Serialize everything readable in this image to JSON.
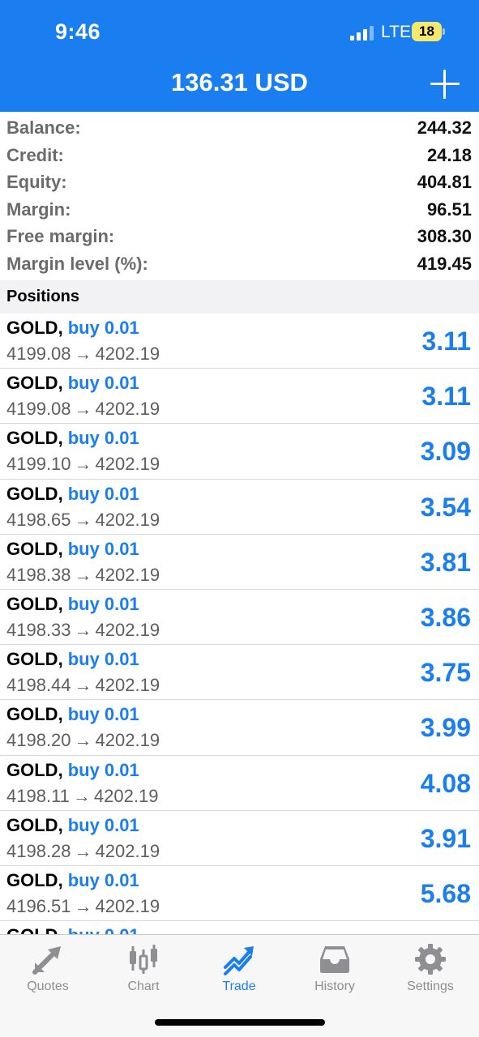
{
  "status_bar": {
    "time": "9:46",
    "network": "LTE",
    "battery": "18"
  },
  "header": {
    "title": "136.31 USD",
    "add_icon": "plus-icon"
  },
  "summary": [
    {
      "label": "Balance:",
      "value": "244.32"
    },
    {
      "label": "Credit:",
      "value": "24.18"
    },
    {
      "label": "Equity:",
      "value": "404.81"
    },
    {
      "label": "Margin:",
      "value": "96.51"
    },
    {
      "label": "Free margin:",
      "value": "308.30"
    },
    {
      "label": "Margin level (%):",
      "value": "419.45"
    }
  ],
  "positions_header": "Positions",
  "positions": [
    {
      "symbol": "GOLD",
      "side": "buy 0.01",
      "open": "4199.08",
      "current": "4202.19",
      "profit": "3.11"
    },
    {
      "symbol": "GOLD",
      "side": "buy 0.01",
      "open": "4199.08",
      "current": "4202.19",
      "profit": "3.11"
    },
    {
      "symbol": "GOLD",
      "side": "buy 0.01",
      "open": "4199.10",
      "current": "4202.19",
      "profit": "3.09"
    },
    {
      "symbol": "GOLD",
      "side": "buy 0.01",
      "open": "4198.65",
      "current": "4202.19",
      "profit": "3.54"
    },
    {
      "symbol": "GOLD",
      "side": "buy 0.01",
      "open": "4198.38",
      "current": "4202.19",
      "profit": "3.81"
    },
    {
      "symbol": "GOLD",
      "side": "buy 0.01",
      "open": "4198.33",
      "current": "4202.19",
      "profit": "3.86"
    },
    {
      "symbol": "GOLD",
      "side": "buy 0.01",
      "open": "4198.44",
      "current": "4202.19",
      "profit": "3.75"
    },
    {
      "symbol": "GOLD",
      "side": "buy 0.01",
      "open": "4198.20",
      "current": "4202.19",
      "profit": "3.99"
    },
    {
      "symbol": "GOLD",
      "side": "buy 0.01",
      "open": "4198.11",
      "current": "4202.19",
      "profit": "4.08"
    },
    {
      "symbol": "GOLD",
      "side": "buy 0.01",
      "open": "4198.28",
      "current": "4202.19",
      "profit": "3.91"
    },
    {
      "symbol": "GOLD",
      "side": "buy 0.01",
      "open": "4196.51",
      "current": "4202.19",
      "profit": "5.68"
    },
    {
      "symbol": "GOLD",
      "side": "buy 0.01"
    }
  ],
  "tabs": [
    {
      "label": "Quotes",
      "icon": "quotes-arrows-icon",
      "active": false
    },
    {
      "label": "Chart",
      "icon": "candlestick-chart-icon",
      "active": false
    },
    {
      "label": "Trade",
      "icon": "trade-trend-icon",
      "active": true
    },
    {
      "label": "History",
      "icon": "history-inbox-icon",
      "active": false
    },
    {
      "label": "Settings",
      "icon": "settings-gear-icon",
      "active": false
    }
  ],
  "colors": {
    "accent": "#1a7ef0",
    "header_bg": "#1a7ef0",
    "label_gray": "#6b6b6b",
    "tab_inactive": "#8e8e93"
  }
}
